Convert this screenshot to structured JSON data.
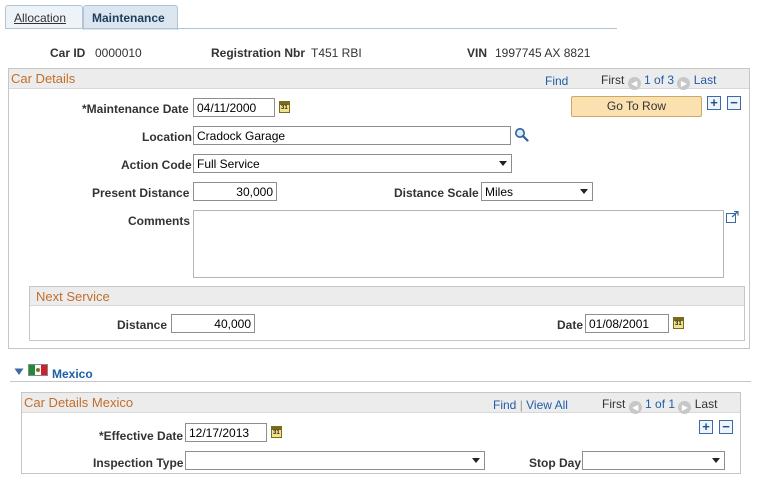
{
  "tabs": [
    {
      "label": "Allocation"
    },
    {
      "label": "Maintenance"
    }
  ],
  "header": {
    "car_id_label": "Car ID",
    "car_id_value": "0000010",
    "reg_label": "Registration Nbr",
    "reg_value": "T451 RBI",
    "vin_label": "VIN",
    "vin_value": "1997745 AX 8821"
  },
  "car_details": {
    "title": "Car Details",
    "find": "Find",
    "first": "First",
    "position": "1 of 3",
    "last": "Last",
    "go_to_row": "Go To Row",
    "maint_date_label": "*Maintenance Date",
    "maint_date_value": "04/11/2000",
    "location_label": "Location",
    "location_value": "Cradock Garage",
    "action_code_label": "Action Code",
    "action_code_value": "Full Service",
    "present_distance_label": "Present Distance",
    "present_distance_value": "30,000",
    "distance_scale_label": "Distance Scale",
    "distance_scale_value": "Miles",
    "comments_label": "Comments",
    "comments_value": ""
  },
  "next_service": {
    "title": "Next Service",
    "distance_label": "Distance",
    "distance_value": "40,000",
    "date_label": "Date",
    "date_value": "01/08/2001"
  },
  "mexico": {
    "section_label": "Mexico",
    "title": "Car Details Mexico",
    "find": "Find",
    "view_all": "View All",
    "first": "First",
    "position": "1 of 1",
    "last": "Last",
    "eff_date_label": "*Effective Date",
    "eff_date_value": "12/17/2013",
    "inspection_type_label": "Inspection Type",
    "inspection_type_value": "",
    "stop_day_label": "Stop Day",
    "stop_day_value": ""
  },
  "colors": {
    "tab_border": "#b0c4d8",
    "box_title": "#c26e2b",
    "link": "#1f5ea8",
    "button_bg": "#fbe1b0"
  }
}
